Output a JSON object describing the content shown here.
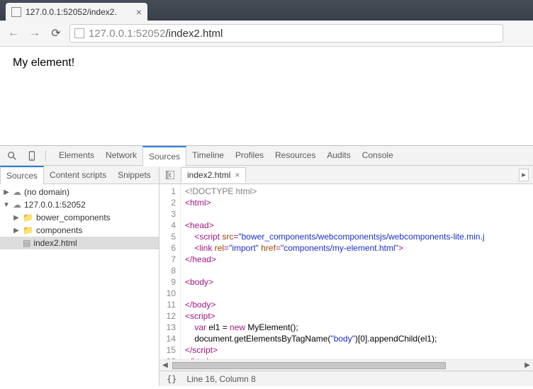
{
  "browser": {
    "tab_title": "127.0.0.1:52052/index2.",
    "url_host": "127.0.0.1",
    "url_port": ":52052",
    "url_path": "/index2.html"
  },
  "page_content": "My element!",
  "devtools": {
    "tabs": [
      "Elements",
      "Network",
      "Sources",
      "Timeline",
      "Profiles",
      "Resources",
      "Audits",
      "Console"
    ],
    "active_tab": "Sources",
    "sub_tabs": [
      "Sources",
      "Content scripts",
      "Snippets"
    ],
    "active_sub_tab": "Sources",
    "open_file": "index2.html",
    "status_line": "Line 16, Column 8",
    "braces": "{}"
  },
  "tree": {
    "nodes": [
      {
        "label": "(no domain)",
        "kind": "cloud",
        "depth": 0,
        "expand": "collapsed"
      },
      {
        "label": "127.0.0.1:52052",
        "kind": "cloud",
        "depth": 0,
        "expand": "expanded"
      },
      {
        "label": "bower_components",
        "kind": "folder",
        "depth": 1,
        "expand": "collapsed"
      },
      {
        "label": "components",
        "kind": "folder",
        "depth": 1,
        "expand": "collapsed"
      },
      {
        "label": "index2.html",
        "kind": "file",
        "depth": 1,
        "expand": "none",
        "selected": true
      }
    ]
  },
  "code": {
    "lines": [
      [
        {
          "t": "doc",
          "v": "<!DOCTYPE html>"
        }
      ],
      [
        {
          "t": "tag",
          "v": "<html>"
        }
      ],
      [],
      [
        {
          "t": "tag",
          "v": "<head>"
        }
      ],
      [
        {
          "t": "txt",
          "v": "    "
        },
        {
          "t": "tag",
          "v": "<script "
        },
        {
          "t": "attr",
          "v": "src"
        },
        {
          "t": "tag",
          "v": "="
        },
        {
          "t": "str",
          "v": "\"bower_components/webcomponentsjs/webcomponents-lite.min.j"
        }
      ],
      [
        {
          "t": "txt",
          "v": "    "
        },
        {
          "t": "tag",
          "v": "<link "
        },
        {
          "t": "attr",
          "v": "rel"
        },
        {
          "t": "tag",
          "v": "="
        },
        {
          "t": "str",
          "v": "\"import\""
        },
        {
          "t": "tag",
          "v": " "
        },
        {
          "t": "attr",
          "v": "href"
        },
        {
          "t": "tag",
          "v": "="
        },
        {
          "t": "str",
          "v": "\"components/my-element.html\""
        },
        {
          "t": "tag",
          "v": ">"
        }
      ],
      [
        {
          "t": "tag",
          "v": "</head>"
        }
      ],
      [],
      [
        {
          "t": "tag",
          "v": "<body>"
        }
      ],
      [],
      [
        {
          "t": "tag",
          "v": "</body>"
        }
      ],
      [
        {
          "t": "tag",
          "v": "<script>"
        }
      ],
      [
        {
          "t": "txt",
          "v": "    "
        },
        {
          "t": "kw",
          "v": "var"
        },
        {
          "t": "txt",
          "v": " el1 = "
        },
        {
          "t": "kw",
          "v": "new"
        },
        {
          "t": "txt",
          "v": " MyElement();"
        }
      ],
      [
        {
          "t": "txt",
          "v": "    document.getElementsByTagName("
        },
        {
          "t": "str",
          "v": "\"body\""
        },
        {
          "t": "txt",
          "v": ")[0].appendChild(el1);"
        }
      ],
      [
        {
          "t": "tag",
          "v": "</scr"
        },
        {
          "t": "tag",
          "v": "ipt>"
        }
      ],
      [
        {
          "t": "tag",
          "v": "</html>"
        }
      ]
    ]
  }
}
